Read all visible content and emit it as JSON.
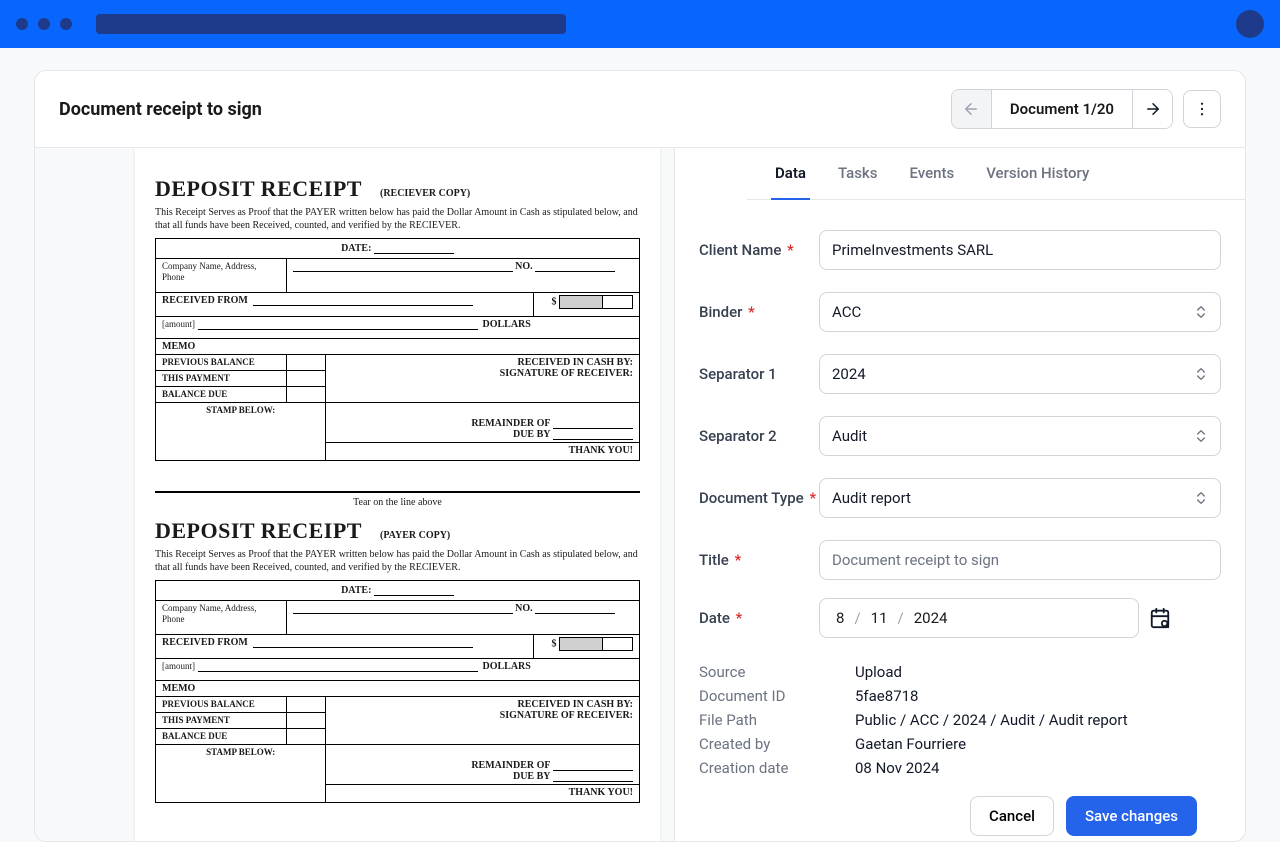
{
  "header": {
    "title": "Document receipt to sign",
    "pager_label": "Document 1/20"
  },
  "tabs": [
    {
      "label": "Data",
      "active": true
    },
    {
      "label": "Tasks",
      "active": false
    },
    {
      "label": "Events",
      "active": false
    },
    {
      "label": "Version History",
      "active": false
    }
  ],
  "form": {
    "client_name": {
      "label": "Client Name",
      "value": "PrimeInvestments SARL",
      "required": true
    },
    "binder": {
      "label": "Binder",
      "value": "ACC",
      "required": true
    },
    "separator1": {
      "label": "Separator 1",
      "value": "2024",
      "required": false
    },
    "separator2": {
      "label": "Separator 2",
      "value": "Audit",
      "required": false
    },
    "document_type": {
      "label": "Document Type",
      "value": "Audit report",
      "required": true
    },
    "title": {
      "label": "Title",
      "value": "Document receipt to sign",
      "required": true
    },
    "date": {
      "label": "Date",
      "day": "8",
      "month": "11",
      "year": "2024",
      "required": true
    }
  },
  "meta": [
    {
      "label": "Source",
      "value": "Upload"
    },
    {
      "label": "Document ID",
      "value": "5fae8718"
    },
    {
      "label": "File Path",
      "value": "Public / ACC / 2024 / Audit / Audit report"
    },
    {
      "label": "Created by",
      "value": "Gaetan Fourriere"
    },
    {
      "label": "Creation date",
      "value": "08 Nov 2024"
    }
  ],
  "buttons": {
    "cancel": "Cancel",
    "save": "Save changes"
  },
  "document": {
    "title": "DEPOSIT RECEIPT",
    "subtitle_receiver": "(RECIEVER COPY)",
    "subtitle_payer": "(PAYER COPY)",
    "desc": "This Receipt Serves as Proof that the PAYER written below has paid the Dollar Amount in Cash as stipulated below, and that all funds have been Received, counted, and verified by the RECIEVER.",
    "date_label": "DATE:",
    "company": "Company Name, Address, Phone",
    "no": "NO.",
    "received_from": "RECEIVED FROM",
    "dollar_sign": "$",
    "amount_hint": "[amount]",
    "dollars": "DOLLARS",
    "memo": "MEMO",
    "prev_balance": "PREVIOUS BALANCE",
    "this_payment": "THIS PAYMENT",
    "balance_due": "BALANCE DUE",
    "received_cash": "RECEIVED IN CASH BY:",
    "signature": "SIGNATURE OF RECEIVER:",
    "stamp": "STAMP BELOW:",
    "remainder": "REMAINDER OF",
    "due_by": "DUE BY",
    "thank_you": "THANK YOU!",
    "tear": "Tear on the line above"
  }
}
